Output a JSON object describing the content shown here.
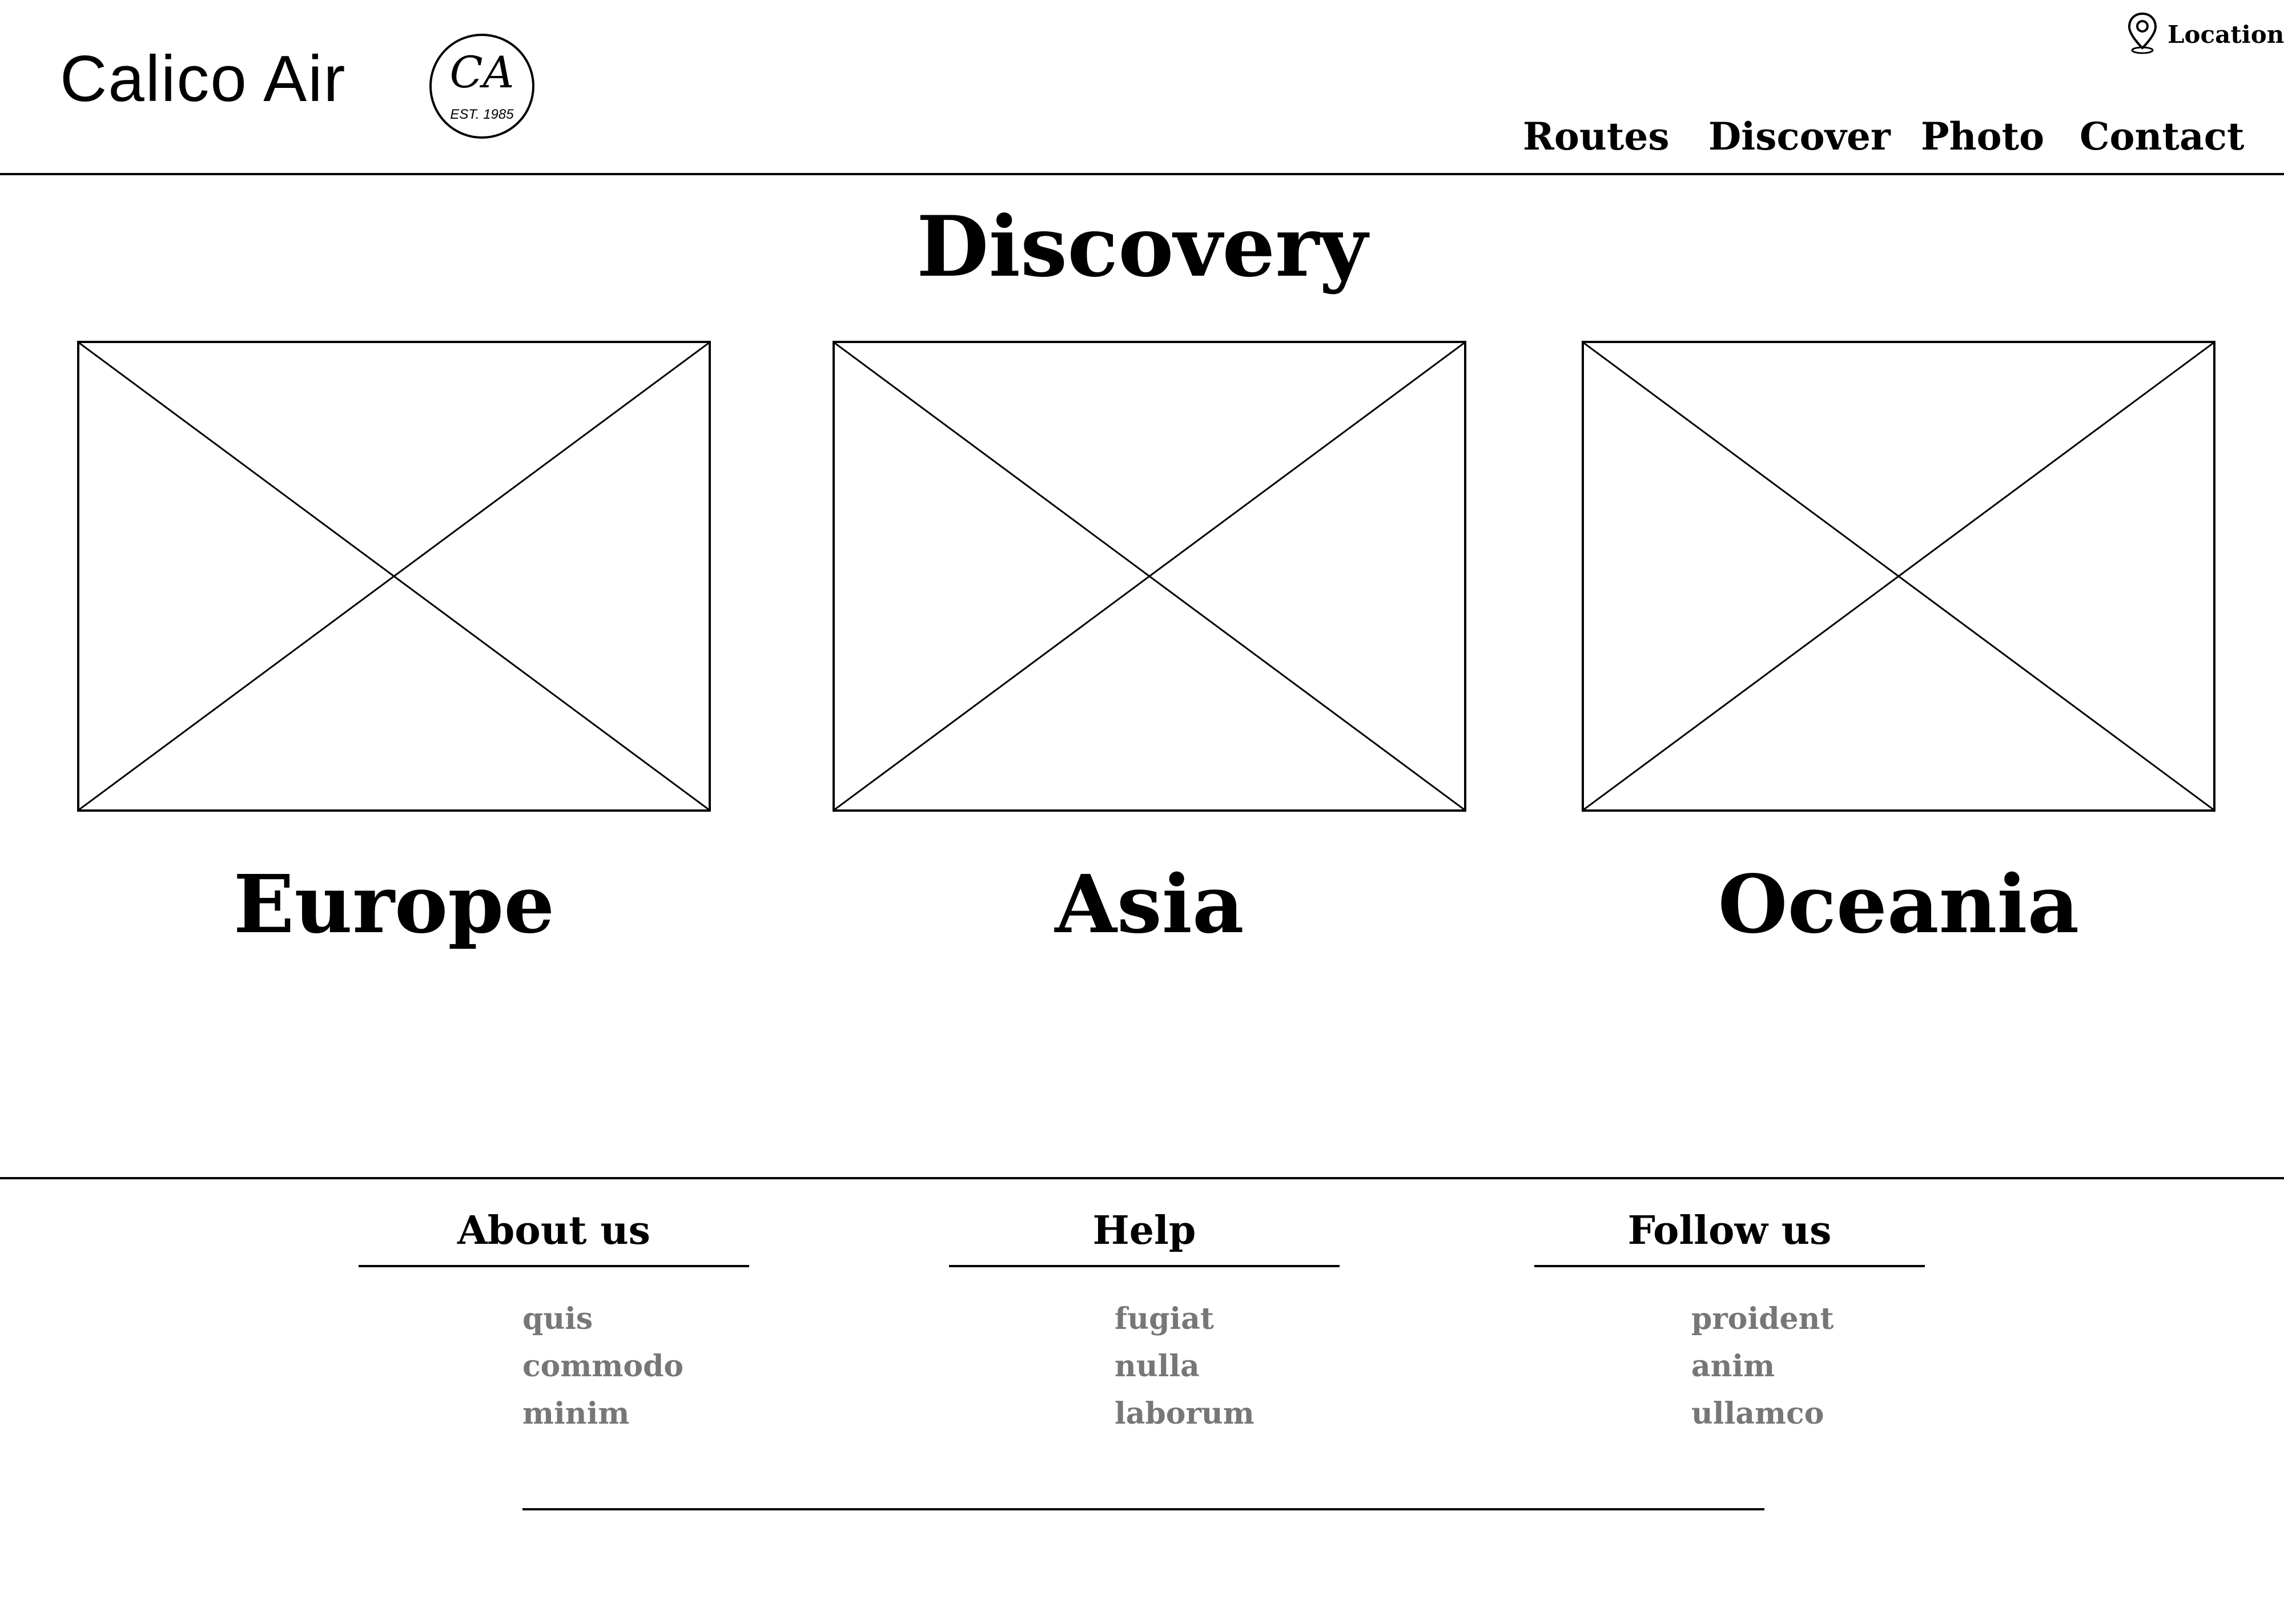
{
  "brand": {
    "name": "Calico Air",
    "monogram": "CA",
    "established": "EST. 1985"
  },
  "location": {
    "label": "Location",
    "icon": "map-pin-icon"
  },
  "nav": {
    "items": [
      {
        "label": "Routes"
      },
      {
        "label": "Discover"
      },
      {
        "label": "Photo"
      },
      {
        "label": "Contact"
      }
    ]
  },
  "page": {
    "title": "Discovery"
  },
  "regions": [
    {
      "label": "Europe",
      "image": "image-placeholder"
    },
    {
      "label": "Asia",
      "image": "image-placeholder"
    },
    {
      "label": "Oceania",
      "image": "image-placeholder"
    }
  ],
  "footer": {
    "columns": [
      {
        "heading": "About us",
        "links": [
          "quis",
          "commodo",
          "minim"
        ]
      },
      {
        "heading": "Help",
        "links": [
          "fugiat",
          "nulla",
          "laborum"
        ]
      },
      {
        "heading": "Follow us",
        "links": [
          "proident",
          "anim",
          "ullamco"
        ]
      }
    ]
  },
  "colors": {
    "text": "#000000",
    "footer_link": "#777777",
    "background": "#ffffff"
  }
}
